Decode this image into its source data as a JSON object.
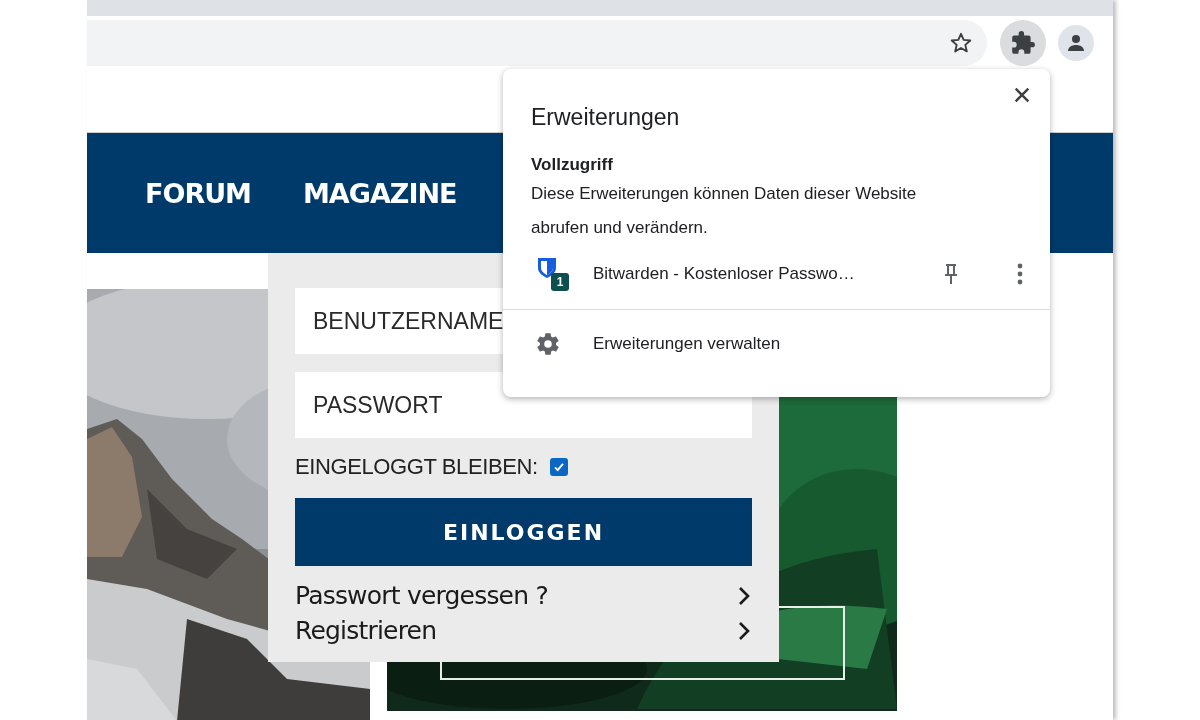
{
  "toolbar": {
    "extensions_button": {
      "selected": true
    }
  },
  "site": {
    "nav": [
      {
        "label": "FORUM"
      },
      {
        "label": "MAGAZINE"
      }
    ],
    "login": {
      "username": {
        "placeholder": "BENUTZERNAME"
      },
      "password": {
        "placeholder": "PASSWORT"
      },
      "remember": {
        "label": "EINGELOGGT BLEIBEN:",
        "checked": true
      },
      "submit": "EINLOGGEN",
      "links": [
        {
          "label": "Passwort vergessen ?"
        },
        {
          "label": "Registrieren"
        }
      ]
    }
  },
  "extensions_popup": {
    "title": "Erweiterungen",
    "section_title": "Vollzugriff",
    "section_text": "Diese Erweiterungen können Daten dieser Website abrufen und verändern.",
    "extensions": [
      {
        "name": "Bitwarden - Kostenloser Passwo…",
        "badge": "1"
      }
    ],
    "manage": "Erweiterungen verwalten"
  }
}
